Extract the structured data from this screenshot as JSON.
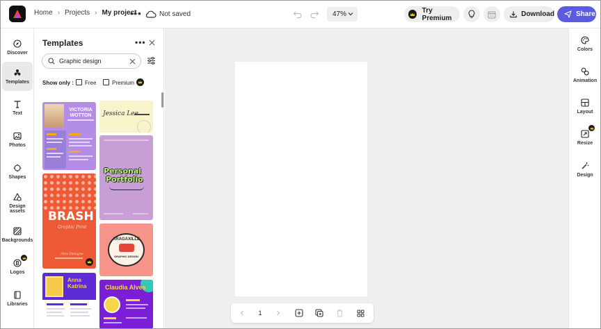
{
  "header": {
    "breadcrumbs": [
      "Home",
      "Projects",
      "My project"
    ],
    "save_status": "Not saved",
    "zoom": "47%",
    "try_premium": "Try Premium",
    "download": "Download",
    "share": "Share"
  },
  "left_rail": {
    "items": [
      {
        "label": "Discover",
        "icon": "compass-icon"
      },
      {
        "label": "Templates",
        "icon": "templates-icon",
        "active": true
      },
      {
        "label": "Text",
        "icon": "text-icon"
      },
      {
        "label": "Photos",
        "icon": "photo-icon"
      },
      {
        "label": "Shapes",
        "icon": "shapes-icon"
      },
      {
        "label": "Design assets",
        "icon": "design-assets-icon"
      },
      {
        "label": "Backgrounds",
        "icon": "backgrounds-icon"
      },
      {
        "label": "Logos",
        "icon": "logos-icon",
        "premium": true
      },
      {
        "label": "Libraries",
        "icon": "libraries-icon"
      }
    ]
  },
  "panel": {
    "title": "Templates",
    "search_value": "Graphic design",
    "show_only": "Show only :",
    "filters": [
      "Free",
      "Premium"
    ],
    "templates": [
      {
        "name": "VICTORIA WOTTON"
      },
      {
        "name": "Jessica Lee"
      },
      {
        "name_line1": "Personal",
        "name_line2": "Portfolio"
      },
      {
        "name": "BRASH",
        "sub": "Graphic Print",
        "foot": "Alex Designs"
      },
      {
        "top": "ARAGAXILLE",
        "bottom": "GRAPHIC DESIGN"
      },
      {
        "name_line1": "Anna",
        "name_line2": "Katrina"
      },
      {
        "name": "Claudia Alves"
      }
    ]
  },
  "page_bar": {
    "page_number": "1"
  },
  "right_rail": {
    "items": [
      {
        "label": "Colors",
        "icon": "palette-icon"
      },
      {
        "label": "Animation",
        "icon": "animation-icon"
      },
      {
        "label": "Layout",
        "icon": "layout-icon"
      },
      {
        "label": "Resize",
        "icon": "resize-icon",
        "premium": true
      },
      {
        "label": "Design",
        "icon": "magic-wand-icon"
      }
    ]
  },
  "colors": {
    "accent": "#5c5ce0",
    "canvas_bg": "#efefef",
    "active_rail_bg": "#e9e9e9"
  }
}
